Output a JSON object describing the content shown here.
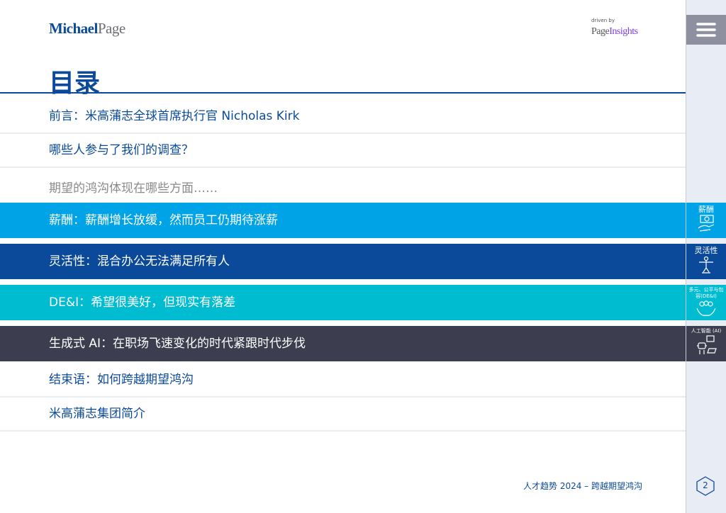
{
  "header": {
    "logo_part1": "Michael",
    "logo_part2": "Page",
    "driven_by": "driven by",
    "pi_part1": "Page",
    "pi_part2": "Insights"
  },
  "title": "目录",
  "toc": [
    {
      "label": "前言：米高蒲志全球首席执行官 Nicholas Kirk"
    },
    {
      "label": "哪些人参与了我们的调查？"
    },
    {
      "label": "期望的鸿沟体现在哪些方面……"
    },
    {
      "label": "薪酬：薪酬增长放缓，然而员工仍期待涨薪",
      "color": "#00a4e6"
    },
    {
      "label": "灵活性：混合办公无法满足所有人",
      "color": "#0b4a9a"
    },
    {
      "label": "DE&I：希望很美好，但现实有落差",
      "color": "#00bcd1"
    },
    {
      "label": "生成式 AI：在职场飞速变化的时代紧跟时代步伐",
      "color": "#3c3e4f"
    },
    {
      "label": "结束语：如何跨越期望鸿沟"
    },
    {
      "label": "米高蒲志集团简介"
    }
  ],
  "side_tabs": [
    {
      "label": "薪酬",
      "icon": "hand-money-icon"
    },
    {
      "label": "灵活性",
      "icon": "person-desk-icon"
    },
    {
      "label": "多元、公平与包容(DE&I)",
      "icon": "people-hands-icon"
    },
    {
      "label": "人工智能 (AI)",
      "icon": "robot-icon"
    }
  ],
  "footer": {
    "text": "人才趋势 2024 – 跨越期望鸿沟",
    "page": "2"
  }
}
